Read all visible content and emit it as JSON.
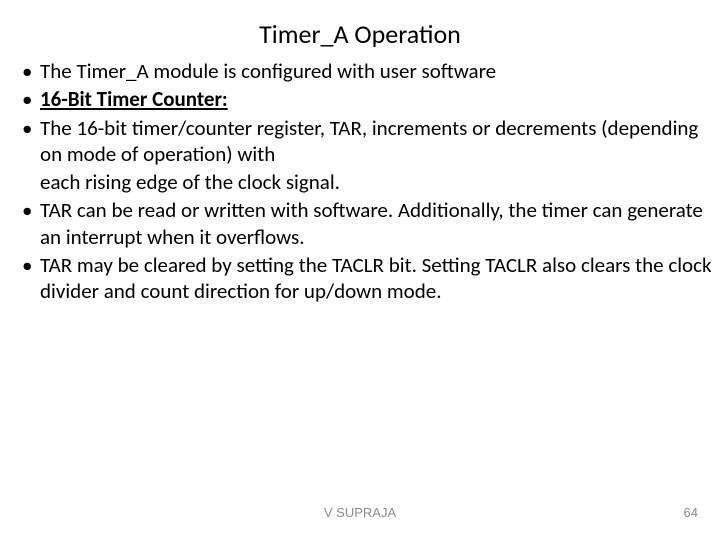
{
  "title": "Timer_A Operation",
  "bullets": {
    "b1": "The Timer_A module is configured with user software",
    "b2": "16-Bit Timer Counter:",
    "b3": "The 16-bit timer/counter register, TAR, increments or decrements (depending on mode of operation) with",
    "b3_sub": "each rising edge of the clock signal.",
    "b4": "TAR can be read or written with software. Additionally, the timer can generate an interrupt when it overflows.",
    "b5": "TAR may be cleared by setting the TACLR bit. Setting TACLR also clears the clock divider and count direction for up/down mode."
  },
  "footer": {
    "author": "V SUPRAJA",
    "page": "64"
  }
}
